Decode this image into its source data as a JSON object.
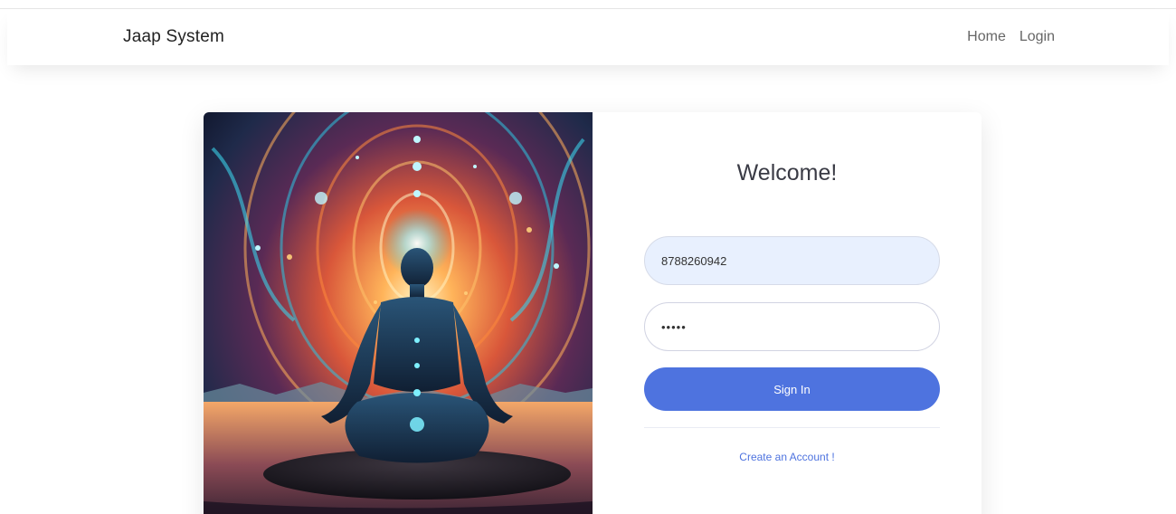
{
  "navbar": {
    "brand": "Jaap System",
    "links": [
      {
        "label": "Home"
      },
      {
        "label": "Login"
      }
    ]
  },
  "login": {
    "heading": "Welcome!",
    "phone_value": "8788260942",
    "password_value": "•••••",
    "submit_label": "Sign In",
    "create_account_label": "Create an Account !"
  },
  "hero": {
    "image": "meditation-illustration",
    "palette": {
      "sky_top": "#1a0f2e",
      "glow": "#ff9a3c",
      "aura": "#2ec4e0",
      "figure": "#1d3a5c",
      "water": "#3a2a3a"
    }
  },
  "colors": {
    "primary": "#4e73df",
    "input_autofill": "#e8f0fe",
    "text_dark": "#3a3b45",
    "nav_text": "#666666"
  }
}
